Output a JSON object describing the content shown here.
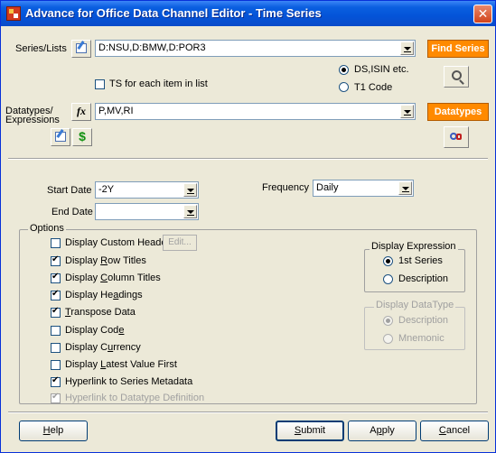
{
  "window": {
    "title": "Advance for Office Data Channel Editor - Time Series",
    "close_glyph": "✕"
  },
  "series": {
    "label": "Series/Lists",
    "value": "D:NSU,D:BMW,D:POR3",
    "find_button": "Find Series",
    "ts_each_label": "TS for each item in list",
    "ts_each_checked": false,
    "code_options": [
      {
        "label": "DS,ISIN etc.",
        "selected": true
      },
      {
        "label": "T1 Code",
        "selected": false
      }
    ]
  },
  "datatypes": {
    "label_line1": "Datatypes/",
    "label_line2": "Expressions",
    "fx_glyph": "fx",
    "value": "P,MV,RI",
    "button": "Datatypes",
    "dollar_glyph": "$"
  },
  "dates": {
    "start_label": "Start Date",
    "start_value": "-2Y",
    "end_label": "End Date",
    "end_value": "",
    "frequency_label": "Frequency",
    "frequency_value": "Daily"
  },
  "options": {
    "legend": "Options",
    "edit_button": "Edit...",
    "items": [
      {
        "pre": "Display Custom Header",
        "ak": "",
        "post": "",
        "checked": false,
        "disabled": false
      },
      {
        "pre": "Display ",
        "ak": "R",
        "post": "ow Titles",
        "checked": true,
        "disabled": false
      },
      {
        "pre": "Display ",
        "ak": "C",
        "post": "olumn Titles",
        "checked": true,
        "disabled": false
      },
      {
        "pre": "Display He",
        "ak": "a",
        "post": "dings",
        "checked": true,
        "disabled": false
      },
      {
        "pre": "",
        "ak": "T",
        "post": "ranspose Data",
        "checked": true,
        "disabled": false
      },
      {
        "pre": "Display Cod",
        "ak": "e",
        "post": "",
        "checked": false,
        "disabled": false
      },
      {
        "pre": "Display C",
        "ak": "u",
        "post": "rrency",
        "checked": false,
        "disabled": false
      },
      {
        "pre": "Display ",
        "ak": "L",
        "post": "atest Value First",
        "checked": false,
        "disabled": false
      },
      {
        "pre": "Hyperlink to Series Metadata",
        "ak": "",
        "post": "",
        "checked": true,
        "disabled": false
      },
      {
        "pre": "Hyperlink to Datatype Definition",
        "ak": "",
        "post": "",
        "checked": true,
        "disabled": true
      }
    ]
  },
  "display_expression": {
    "legend": "Display Expression",
    "options": [
      {
        "label": "1st Series",
        "selected": true
      },
      {
        "label": "Description",
        "selected": false
      }
    ]
  },
  "display_datatype": {
    "legend": "Display DataType",
    "options": [
      {
        "label": "Description",
        "selected": true
      },
      {
        "label": "Mnemonic",
        "selected": false
      }
    ]
  },
  "buttons": {
    "help": {
      "pre": "",
      "ak": "H",
      "post": "elp"
    },
    "submit": {
      "pre": "",
      "ak": "S",
      "post": "ubmit"
    },
    "apply": {
      "pre": "A",
      "ak": "p",
      "post": "ply"
    },
    "cancel": {
      "pre": "",
      "ak": "C",
      "post": "ancel"
    }
  }
}
